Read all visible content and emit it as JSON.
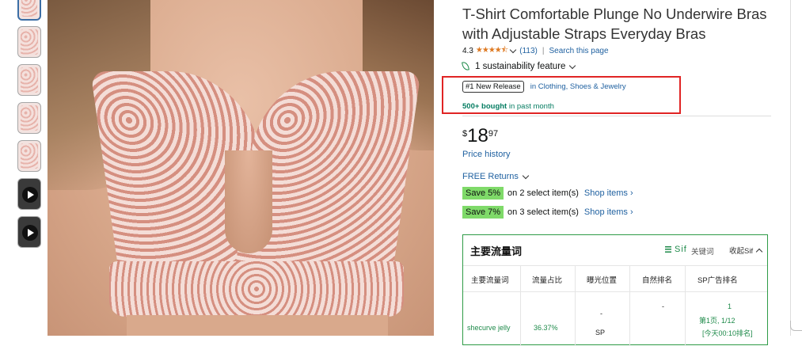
{
  "product": {
    "title": "T-Shirt Comfortable Plunge No Underwire Bras with Adjustable Straps Everyday Bras",
    "rating": "4.3",
    "stars": "★★★★⯪",
    "review_count": "(113)",
    "search_page": "Search this page",
    "sustainability": "1 sustainability feature",
    "badge": "#1 New Release",
    "badge_category": "in Clothing, Shoes & Jewelry",
    "bought_bold": "500+ bought",
    "bought_rest": " in past month",
    "price": {
      "symbol": "$",
      "whole": "18",
      "fraction": "97"
    },
    "price_history": "Price history",
    "returns": "FREE Returns",
    "coupons": [
      {
        "save": "Save 5%",
        "condition": "on 2 select item(s)",
        "link": "Shop items ›"
      },
      {
        "save": "Save 7%",
        "condition": "on 3 select item(s)",
        "link": "Shop items ›"
      }
    ]
  },
  "colors": {
    "link": "#2162a1",
    "star": "#de7921",
    "coupon": "#7fda69",
    "panel_border": "#2e9b46",
    "highlight": "#e02424",
    "green_text": "#067d62"
  },
  "thumbnails": [
    {
      "kind": "image",
      "selected": true
    },
    {
      "kind": "image"
    },
    {
      "kind": "image"
    },
    {
      "kind": "image"
    },
    {
      "kind": "image"
    },
    {
      "kind": "video",
      "icon": "play-icon"
    },
    {
      "kind": "video",
      "icon": "play-icon"
    }
  ],
  "traffic_panel": {
    "title": "主要流量词",
    "sif_label": "Sif",
    "keyword_label": "关键词",
    "collapse_label": "收起Sif",
    "columns": [
      "主要流量词",
      "流量占比",
      "曝光位置",
      "自然排名",
      "SP广告排名"
    ],
    "row": {
      "keyword": "shecurve jelly",
      "share": "36.37%",
      "exposure_dash": "-",
      "exposure_sp": "SP",
      "natural_rank": "-",
      "sp_rank": "1",
      "sp_page": "第1页, 1/12",
      "sp_time": "[今天00:10排名]"
    }
  }
}
